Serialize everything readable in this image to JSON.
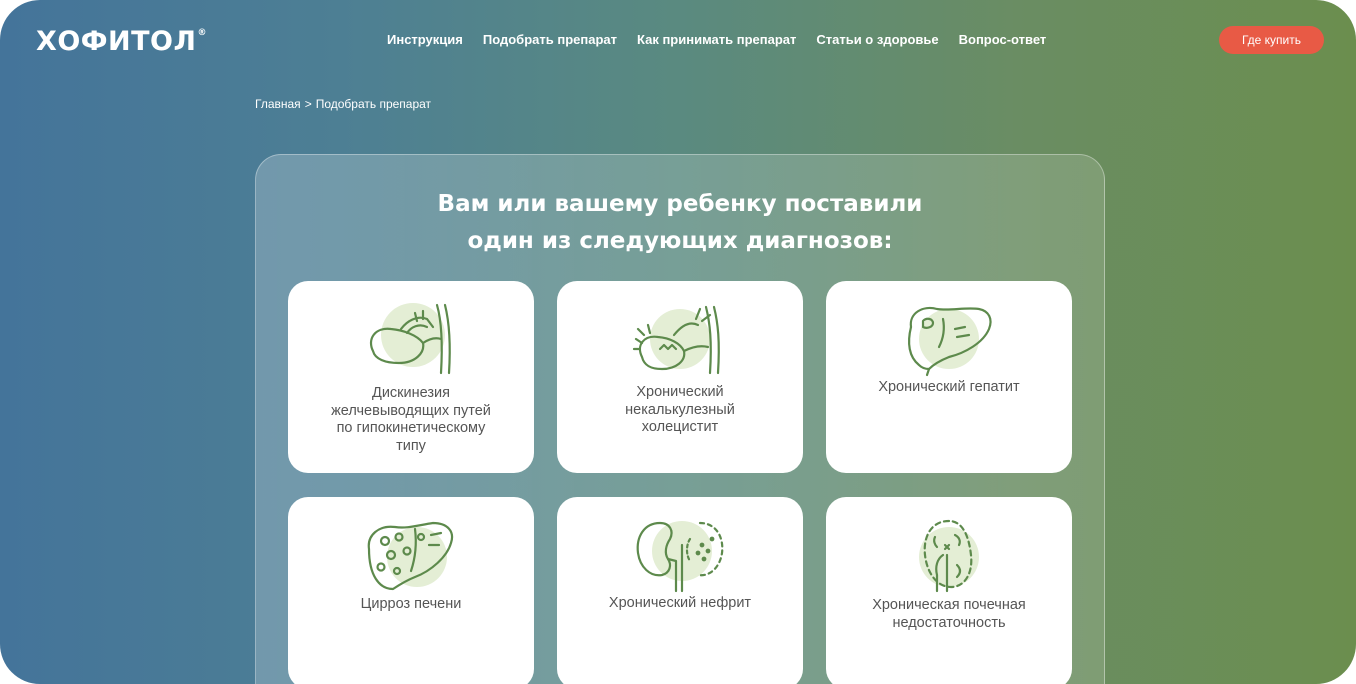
{
  "header": {
    "logo": "ХОФИТОЛ",
    "logo_mark": "®",
    "nav": [
      "Инструкция",
      "Подобрать препарат",
      "Как принимать препарат",
      "Статьи о здоровье",
      "Вопрос-ответ"
    ],
    "buy_label": "Где купить"
  },
  "breadcrumb": {
    "home": "Главная",
    "separator": ">",
    "current": "Подобрать препарат"
  },
  "main": {
    "heading_line1": "Вам или вашему ребенку поставили",
    "heading_line2": "один из следующих диагнозов:"
  },
  "diagnoses": [
    {
      "icon": "gallbladder-icon",
      "lines": [
        "Дискинезия",
        "желчевыводящих путей",
        "по гипокинетическому",
        "типу"
      ]
    },
    {
      "icon": "inflamed-gallbladder-icon",
      "lines": [
        "Хронический",
        "некалькулезный",
        "холецистит"
      ]
    },
    {
      "icon": "liver-icon",
      "lines": [
        "Хронический гепатит"
      ]
    },
    {
      "icon": "cirrhotic-liver-icon",
      "lines": [
        "Цирроз печени"
      ]
    },
    {
      "icon": "kidney-icon",
      "lines": [
        "Хронический нефрит"
      ]
    },
    {
      "icon": "kidney-failure-icon",
      "lines": [
        "Хроническая почечная",
        "недостаточность"
      ]
    }
  ],
  "colors": {
    "accent_green": "#5d8a4c",
    "icon_blob": "#e4eed5",
    "buy_button": "#e85a45"
  }
}
